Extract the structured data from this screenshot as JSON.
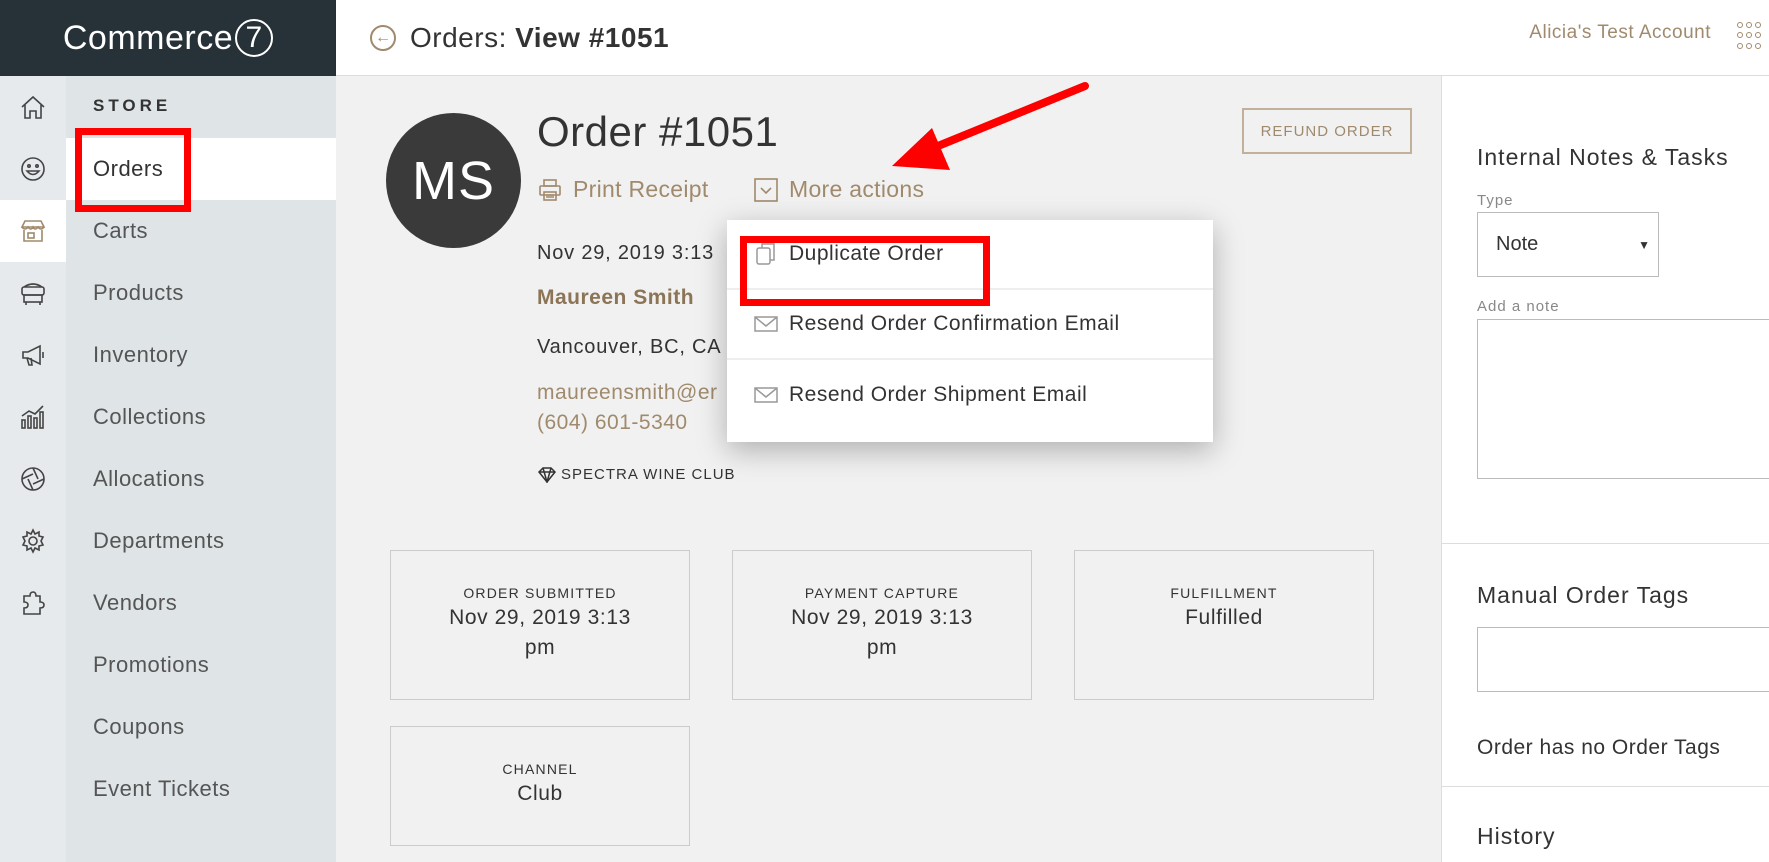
{
  "brand": {
    "name": "Commerce",
    "mark": "7"
  },
  "header": {
    "title_prefix": "Orders:",
    "title_main": "View #1051",
    "account": "Alicia's Test Account"
  },
  "nav": {
    "section": "STORE",
    "items": [
      {
        "label": "Orders",
        "active": true
      },
      {
        "label": "Carts"
      },
      {
        "label": "Products"
      },
      {
        "label": "Inventory"
      },
      {
        "label": "Collections"
      },
      {
        "label": "Allocations"
      },
      {
        "label": "Departments"
      },
      {
        "label": "Vendors"
      },
      {
        "label": "Promotions"
      },
      {
        "label": "Coupons"
      },
      {
        "label": "Event Tickets"
      }
    ]
  },
  "order": {
    "avatar_initials": "MS",
    "title": "Order #1051",
    "refund_label": "REFUND ORDER",
    "print_label": "Print Receipt",
    "more_label": "More actions",
    "date": "Nov 29, 2019 3:13",
    "customer_name": "Maureen Smith",
    "location": "Vancouver, BC, CA",
    "email": "maureensmith@er",
    "phone": "(604) 601-5340",
    "club": "SPECTRA WINE CLUB"
  },
  "cards": [
    {
      "label": "ORDER SUBMITTED",
      "value": "Nov 29, 2019 3:13 pm"
    },
    {
      "label": "PAYMENT CAPTURE",
      "value": "Nov 29, 2019 3:13 pm"
    },
    {
      "label": "FULFILLMENT",
      "value": "Fulfilled"
    },
    {
      "label": "CHANNEL",
      "value": "Club"
    }
  ],
  "dropdown": {
    "items": [
      {
        "label": "Duplicate Order",
        "icon": "duplicate-icon"
      },
      {
        "label": "Resend Order Confirmation Email",
        "icon": "envelope-icon"
      },
      {
        "label": "Resend Order Shipment Email",
        "icon": "envelope-icon"
      }
    ]
  },
  "right_panel": {
    "notes_title": "Internal Notes & Tasks",
    "type_label": "Type",
    "type_value": "Note",
    "add_note_label": "Add a note",
    "tags_title": "Manual Order Tags",
    "no_tags_text": "Order has no Order Tags",
    "history_title": "History"
  },
  "colors": {
    "accent": "#a08a6d",
    "brand_bg": "#263238",
    "annotation": "#ff0000"
  }
}
